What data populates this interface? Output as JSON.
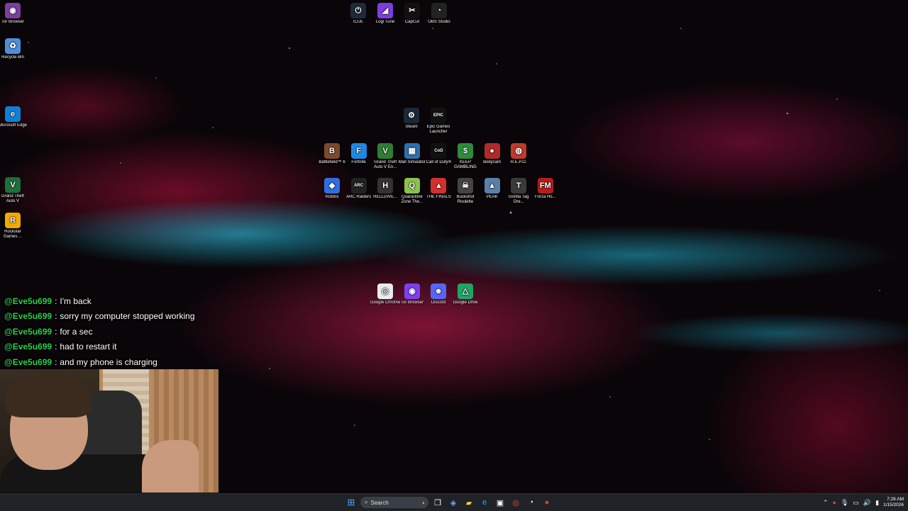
{
  "desktop": {
    "left_column": [
      {
        "label": "Tor Browser",
        "color": "#7b3fa0",
        "glyph": "◉"
      },
      {
        "label": "Recycle Bin",
        "color": "#4a90d9",
        "glyph": "♻"
      },
      {
        "label": "Microsoft Edge",
        "color": "#0f7fd6",
        "glyph": "e"
      },
      {
        "label": "Grand Theft Auto V",
        "color": "#1e6f3a",
        "glyph": "V"
      },
      {
        "label": "Rockstar Games ...",
        "color": "#f2a900",
        "glyph": "R"
      }
    ],
    "top_row": [
      {
        "label": "iCUE",
        "color": "#1d2b3a",
        "glyph": "⏻"
      },
      {
        "label": "Logi Tune",
        "color": "#7b3fe0",
        "glyph": "◢"
      },
      {
        "label": "CapCut",
        "color": "#111111",
        "glyph": "✂"
      },
      {
        "label": "OBS Studio",
        "color": "#222222",
        "glyph": "◔"
      }
    ],
    "launchers": [
      {
        "label": "Steam",
        "color": "#1b2838",
        "glyph": "⚙"
      },
      {
        "label": "Epic Games Launcher",
        "color": "#111111",
        "glyph": "EPIC"
      }
    ],
    "games_row1": [
      {
        "label": "Battlefield™ 6",
        "color": "#7a4a2a",
        "glyph": "B"
      },
      {
        "label": "Fortnite",
        "color": "#1e88e5",
        "glyph": "F"
      },
      {
        "label": "Grand Theft Auto V En...",
        "color": "#2e7d32",
        "glyph": "V"
      },
      {
        "label": "Mall Simulator",
        "color": "#2e6fb0",
        "glyph": "▦"
      },
      {
        "label": "Call of Duty®",
        "color": "#111111",
        "glyph": "CoD"
      },
      {
        "label": "KEEP GAMBLING",
        "color": "#2e8b3a",
        "glyph": "$"
      },
      {
        "label": "Bodycam",
        "color": "#b02a2a",
        "glyph": "●"
      },
      {
        "label": "R.E.P.O.",
        "color": "#c0392b",
        "glyph": "◍"
      }
    ],
    "games_row2": [
      {
        "label": "Roblox",
        "color": "#2f6fe0",
        "glyph": "◆"
      },
      {
        "label": "ARC Raiders",
        "color": "#222222",
        "glyph": "ARC"
      },
      {
        "label": "HELLDIVE...",
        "color": "#333333",
        "glyph": "H"
      },
      {
        "label": "Quarantine Zone The...",
        "color": "#8bc34a",
        "glyph": "Q"
      },
      {
        "label": "THE FINALS",
        "color": "#d32f2f",
        "glyph": "▲"
      },
      {
        "label": "Buckshot Roulette",
        "color": "#444444",
        "glyph": "☠"
      },
      {
        "label": "PEAK",
        "color": "#5c7fa8",
        "glyph": "▲"
      },
      {
        "label": "Gorilla Tag Ore...",
        "color": "#3a3a3a",
        "glyph": "T"
      },
      {
        "label": "Forza Ho...",
        "color": "#b71c1c",
        "glyph": "FM"
      }
    ],
    "bottom_row": [
      {
        "label": "Google Chrome",
        "color": "#e8eaed",
        "glyph": "◎"
      },
      {
        "label": "Tor Browser",
        "color": "#7e3ff2",
        "glyph": "◉"
      },
      {
        "label": "Discord",
        "color": "#5865f2",
        "glyph": "☻"
      },
      {
        "label": "Google Drive",
        "color": "#1fa463",
        "glyph": "△"
      }
    ]
  },
  "chat": {
    "separator": ":",
    "messages": [
      {
        "user": "@Eve5u699",
        "text": "I'm back"
      },
      {
        "user": "@Eve5u699",
        "text": "sorry my computer stopped working"
      },
      {
        "user": "@Eve5u699",
        "text": "for a sec"
      },
      {
        "user": "@Eve5u699",
        "text": "had to restart it"
      },
      {
        "user": "@Eve5u699",
        "text": "and my phone is charging"
      }
    ]
  },
  "taskbar": {
    "start_icon": "windows-start-icon",
    "search_placeholder": "Search",
    "pinned": [
      {
        "name": "taskview",
        "glyph": "❐",
        "color": "#ffffff"
      },
      {
        "name": "copilot",
        "glyph": "◈",
        "color": "#6ea8ff"
      },
      {
        "name": "file-explorer",
        "glyph": "▰",
        "color": "#f5c542"
      },
      {
        "name": "edge",
        "glyph": "e",
        "color": "#2fa3ff"
      },
      {
        "name": "store",
        "glyph": "▣",
        "color": "#ffffff"
      },
      {
        "name": "chrome",
        "glyph": "◎",
        "color": "#f04b3e"
      },
      {
        "name": "obs",
        "glyph": "◔",
        "color": "#ffffff"
      },
      {
        "name": "recorder",
        "glyph": "●",
        "color": "#e53935"
      }
    ],
    "clock": {
      "time": "7:28 AM",
      "date": "1/15/2026"
    }
  }
}
